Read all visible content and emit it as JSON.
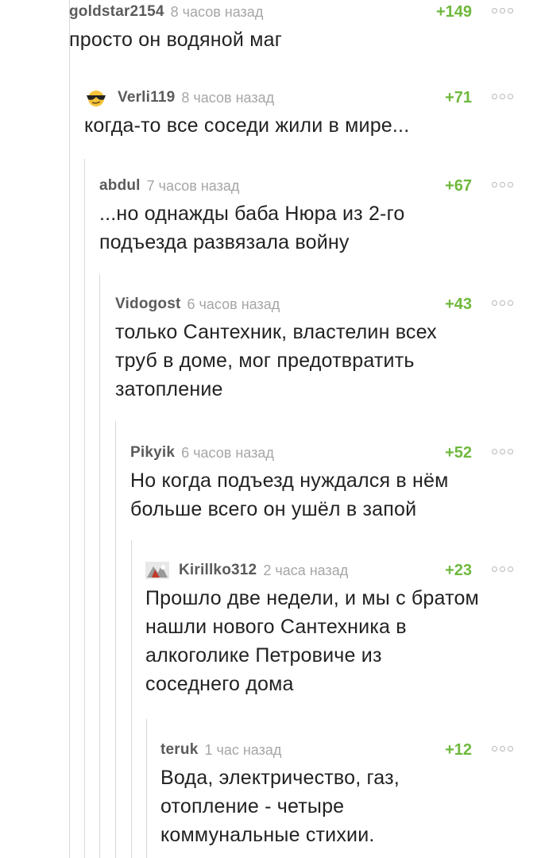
{
  "comments": [
    {
      "author": "goldstar2154",
      "time": "8 часов назад",
      "rating": "+149",
      "text": "просто он водяной маг"
    },
    {
      "author": "Verli119",
      "time": "8 часов назад",
      "rating": "+71",
      "text": "когда-то все соседи жили в мире..."
    },
    {
      "author": "abdul",
      "time": "7 часов назад",
      "rating": "+67",
      "text_lines": [
        "...но однажды баба Нюра из 2-го",
        "подъезда развязала войну"
      ]
    },
    {
      "author": "Vidogost",
      "time": "6 часов назад",
      "rating": "+43",
      "text_lines": [
        "только Сантехник, властелин всех",
        "труб в доме, мог предотвратить",
        "затопление"
      ]
    },
    {
      "author": "Pikyik",
      "time": "6 часов назад",
      "rating": "+52",
      "text_lines": [
        "Но когда подъезд нуждался в нём",
        "больше всего он ушёл в запой"
      ]
    },
    {
      "author": "Kirillko312",
      "time": "2 часа назад",
      "rating": "+23",
      "text_lines": [
        "Прошло две недели, и мы с братом",
        "нашли нового Сантехника в",
        "алкоголике Петровиче из",
        "соседнего дома"
      ]
    },
    {
      "author": "teruk",
      "time": "1 час назад",
      "rating": "+12",
      "text_lines": [
        "Вода, электричество, газ,",
        "отопление - четыре",
        "коммунальные стихии."
      ]
    }
  ],
  "icons": {
    "more": "more-options-icon",
    "avatar_verli": "sunglasses-smiley-icon",
    "avatar_kirillko": "user-avatar-image"
  },
  "colors": {
    "rating": "#6fb83d",
    "author": "#5b5b5b",
    "time": "#a6a6a6",
    "text": "#222222",
    "thread_line": "#d8d8d8"
  }
}
